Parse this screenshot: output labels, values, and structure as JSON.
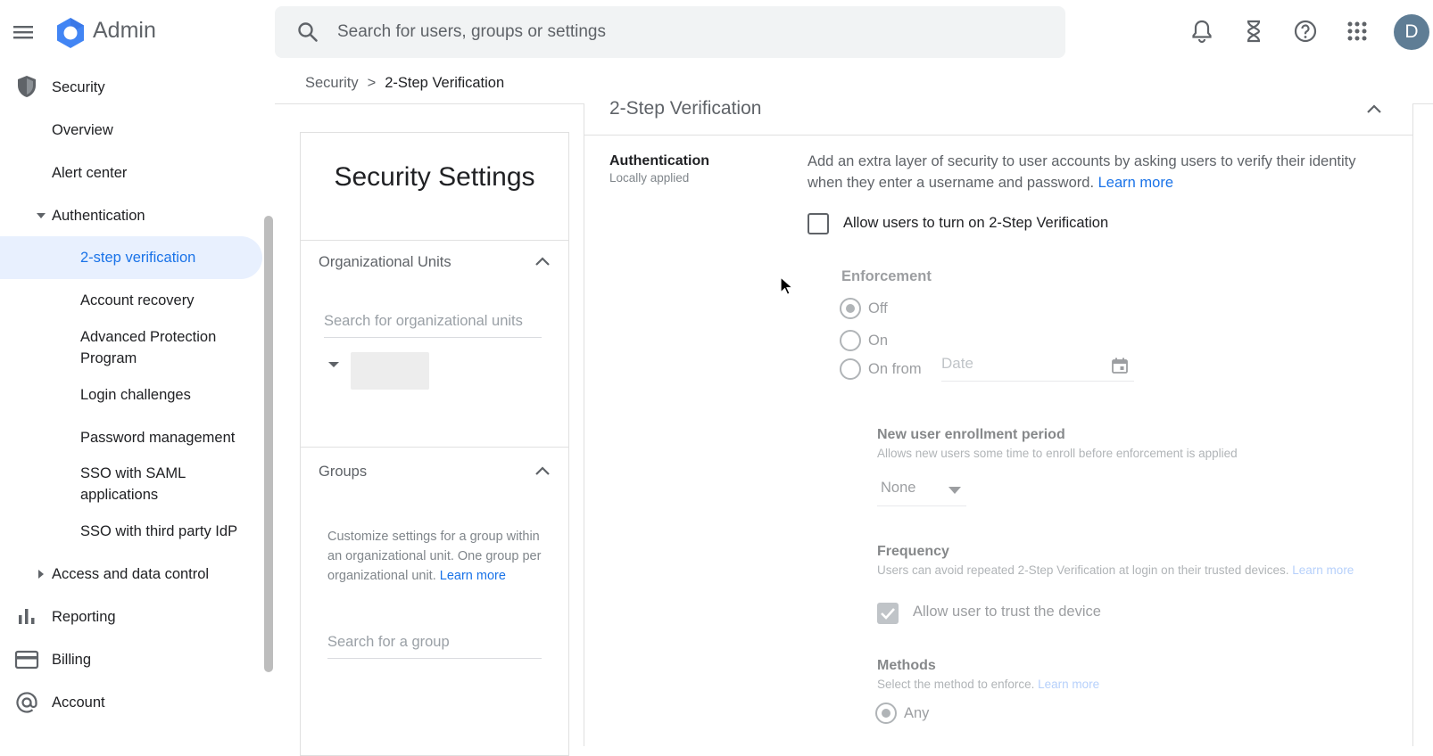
{
  "topbar": {
    "app_title": "Admin",
    "search_placeholder": "Search for users, groups or settings",
    "avatar_letter": "D",
    "icons": [
      "menu-icon",
      "admin-logo-icon",
      "search-icon",
      "notifications-bell-icon",
      "tasks-hourglass-icon",
      "help-icon",
      "apps-grid-icon"
    ]
  },
  "sidebar": {
    "security": "Security",
    "overview": "Overview",
    "alert_center": "Alert center",
    "authentication": "Authentication",
    "two_step": "2-step verification",
    "account_recovery": "Account recovery",
    "advanced_protection": "Advanced Protection Program",
    "login_challenges": "Login challenges",
    "password_management": "Password management",
    "sso_saml": "SSO with SAML applications",
    "sso_third_party": "SSO with third party IdP",
    "access_data_control": "Access and data control",
    "reporting": "Reporting",
    "billing": "Billing",
    "account": "Account"
  },
  "breadcrumb": {
    "parent": "Security",
    "separator": ">",
    "current": "2-Step Verification"
  },
  "left_panel": {
    "title": "Security Settings",
    "org_units_heading": "Organizational Units",
    "org_units_search_placeholder": "Search for organizational units",
    "groups_heading": "Groups",
    "groups_description": "Customize settings for a group within an organizational unit. One group per organizational unit.",
    "groups_learn_more": "Learn more",
    "groups_search_placeholder": "Search for a group"
  },
  "content": {
    "section_title": "2-Step Verification",
    "auth_label": "Authentication",
    "auth_sublabel": "Locally applied",
    "auth_description": "Add an extra layer of security to user accounts by asking users to verify their identity when they enter a username and password.",
    "auth_learn_more": "Learn more",
    "allow_checkbox_label": "Allow users to turn on 2-Step Verification",
    "allow_checked": false,
    "enforcement": {
      "title": "Enforcement",
      "options": [
        "Off",
        "On",
        "On from"
      ],
      "selected": "Off",
      "date_placeholder": "Date"
    },
    "enrollment": {
      "title": "New user enrollment period",
      "description": "Allows new users some time to enroll before enforcement is applied",
      "selected": "None"
    },
    "frequency": {
      "title": "Frequency",
      "description": "Users can avoid repeated 2-Step Verification at login on their trusted devices.",
      "learn_more": "Learn more",
      "trust_label": "Allow user to trust the device",
      "trust_checked": true
    },
    "methods": {
      "title": "Methods",
      "description": "Select the method to enforce.",
      "learn_more": "Learn more",
      "first_option": "Any"
    }
  },
  "colors": {
    "accent": "#1a73e8",
    "active_nav_bg": "#e8f0fe",
    "logo_blue": "#4285f4"
  }
}
